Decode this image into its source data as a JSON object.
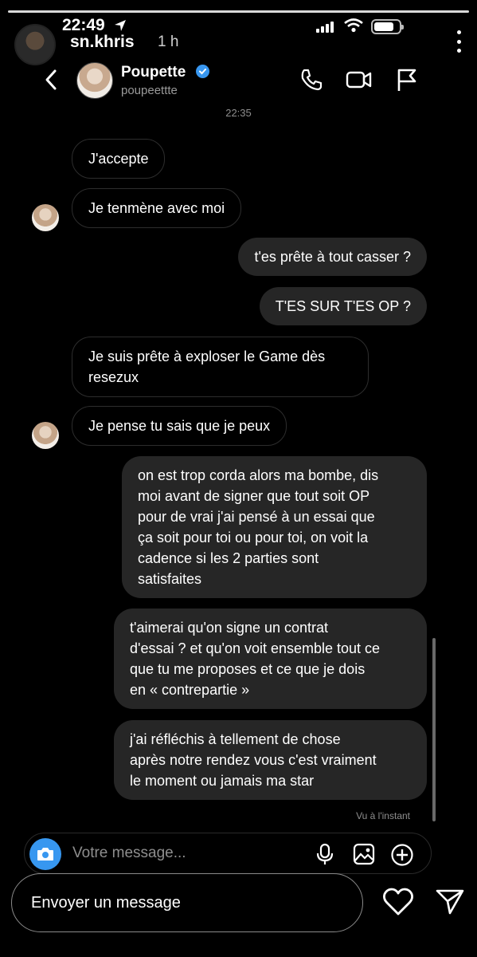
{
  "story": {
    "username": "sn.khris",
    "time_ago": "1 h",
    "reply_placeholder": "Envoyer un message"
  },
  "status_bar": {
    "time": "22:49"
  },
  "chat": {
    "contact_name": "Poupette",
    "contact_handle": "poupeettte",
    "timestamp": "22:35",
    "seen_label": "Vu à l'instant",
    "composer_placeholder": "Votre message..."
  },
  "messages": [
    {
      "side": "in",
      "text": "J'accepte"
    },
    {
      "side": "in",
      "text": "Je tenmène avec moi"
    },
    {
      "side": "out",
      "text": "t'es prête à tout casser ?"
    },
    {
      "side": "out",
      "text": "T'ES SUR T'ES OP ?"
    },
    {
      "side": "in",
      "text": "Je suis prête à exploser le Game dès\nresezux"
    },
    {
      "side": "in",
      "text": "Je pense tu sais que je peux"
    },
    {
      "side": "out",
      "text": "on est trop corda alors ma bombe, dis\nmoi avant de signer que tout soit OP\npour de vrai j'ai pensé à un essai que\nça soit pour toi ou pour toi, on voit la\ncadence si les 2 parties sont\nsatisfaites"
    },
    {
      "side": "out",
      "text": "t'aimerai qu'on signe un contrat\nd'essai ? et qu'on voit ensemble tout ce\nque tu me proposes et ce que je dois\nen « contrepartie »"
    },
    {
      "side": "out",
      "text": "j'ai réfléchis à tellement de chose\naprès notre rendez vous c'est vraiment\nle moment ou jamais ma star"
    }
  ],
  "colors": {
    "background": "#000000",
    "outgoing_bubble": "#262626",
    "verified_blue": "#3897f0",
    "camera_button": "#3797f0"
  }
}
